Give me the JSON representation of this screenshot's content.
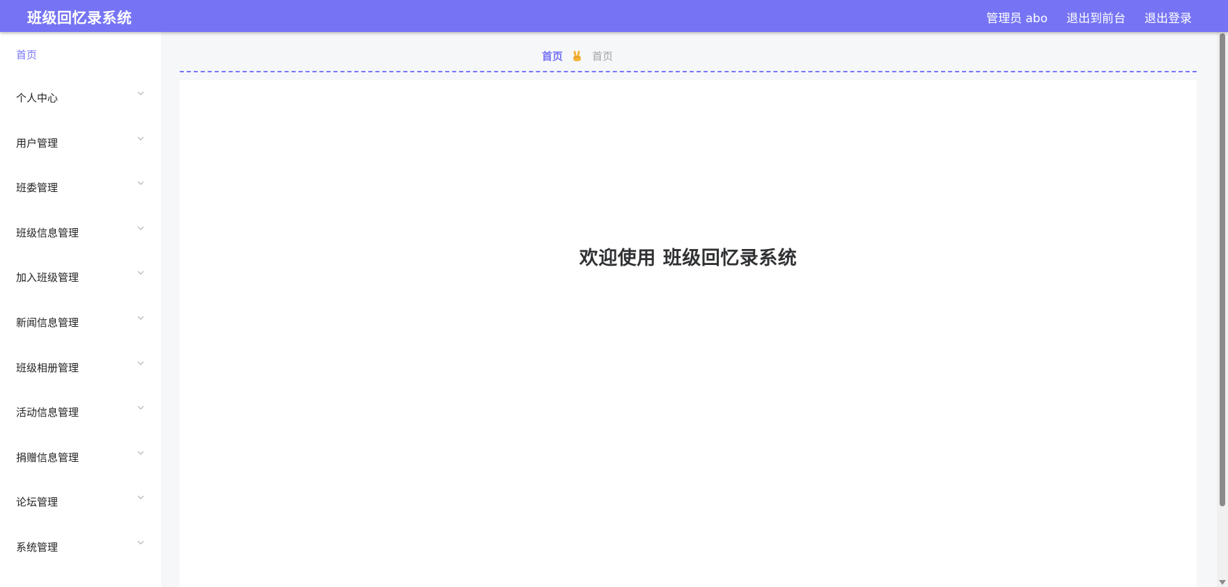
{
  "header": {
    "title": "班级回忆录系统",
    "admin_label": "管理员 abo",
    "front_label": "退出到前台",
    "logout_label": "退出登录",
    "bg_color": "#7674f4"
  },
  "sidebar": {
    "home_label": "首页",
    "items": [
      {
        "label": "个人中心"
      },
      {
        "label": "用户管理"
      },
      {
        "label": "班委管理"
      },
      {
        "label": "班级信息管理"
      },
      {
        "label": "加入班级管理"
      },
      {
        "label": "新闻信息管理"
      },
      {
        "label": "班级相册管理"
      },
      {
        "label": "活动信息管理"
      },
      {
        "label": "捐赠信息管理"
      },
      {
        "label": "论坛管理"
      },
      {
        "label": "系统管理"
      }
    ],
    "chevron_icon": "chevron-down-icon"
  },
  "breadcrumb": {
    "first": "首页",
    "separator_icon": "victory-hand-icon",
    "current": "首页"
  },
  "main": {
    "welcome": "欢迎使用 班级回忆录系统"
  }
}
